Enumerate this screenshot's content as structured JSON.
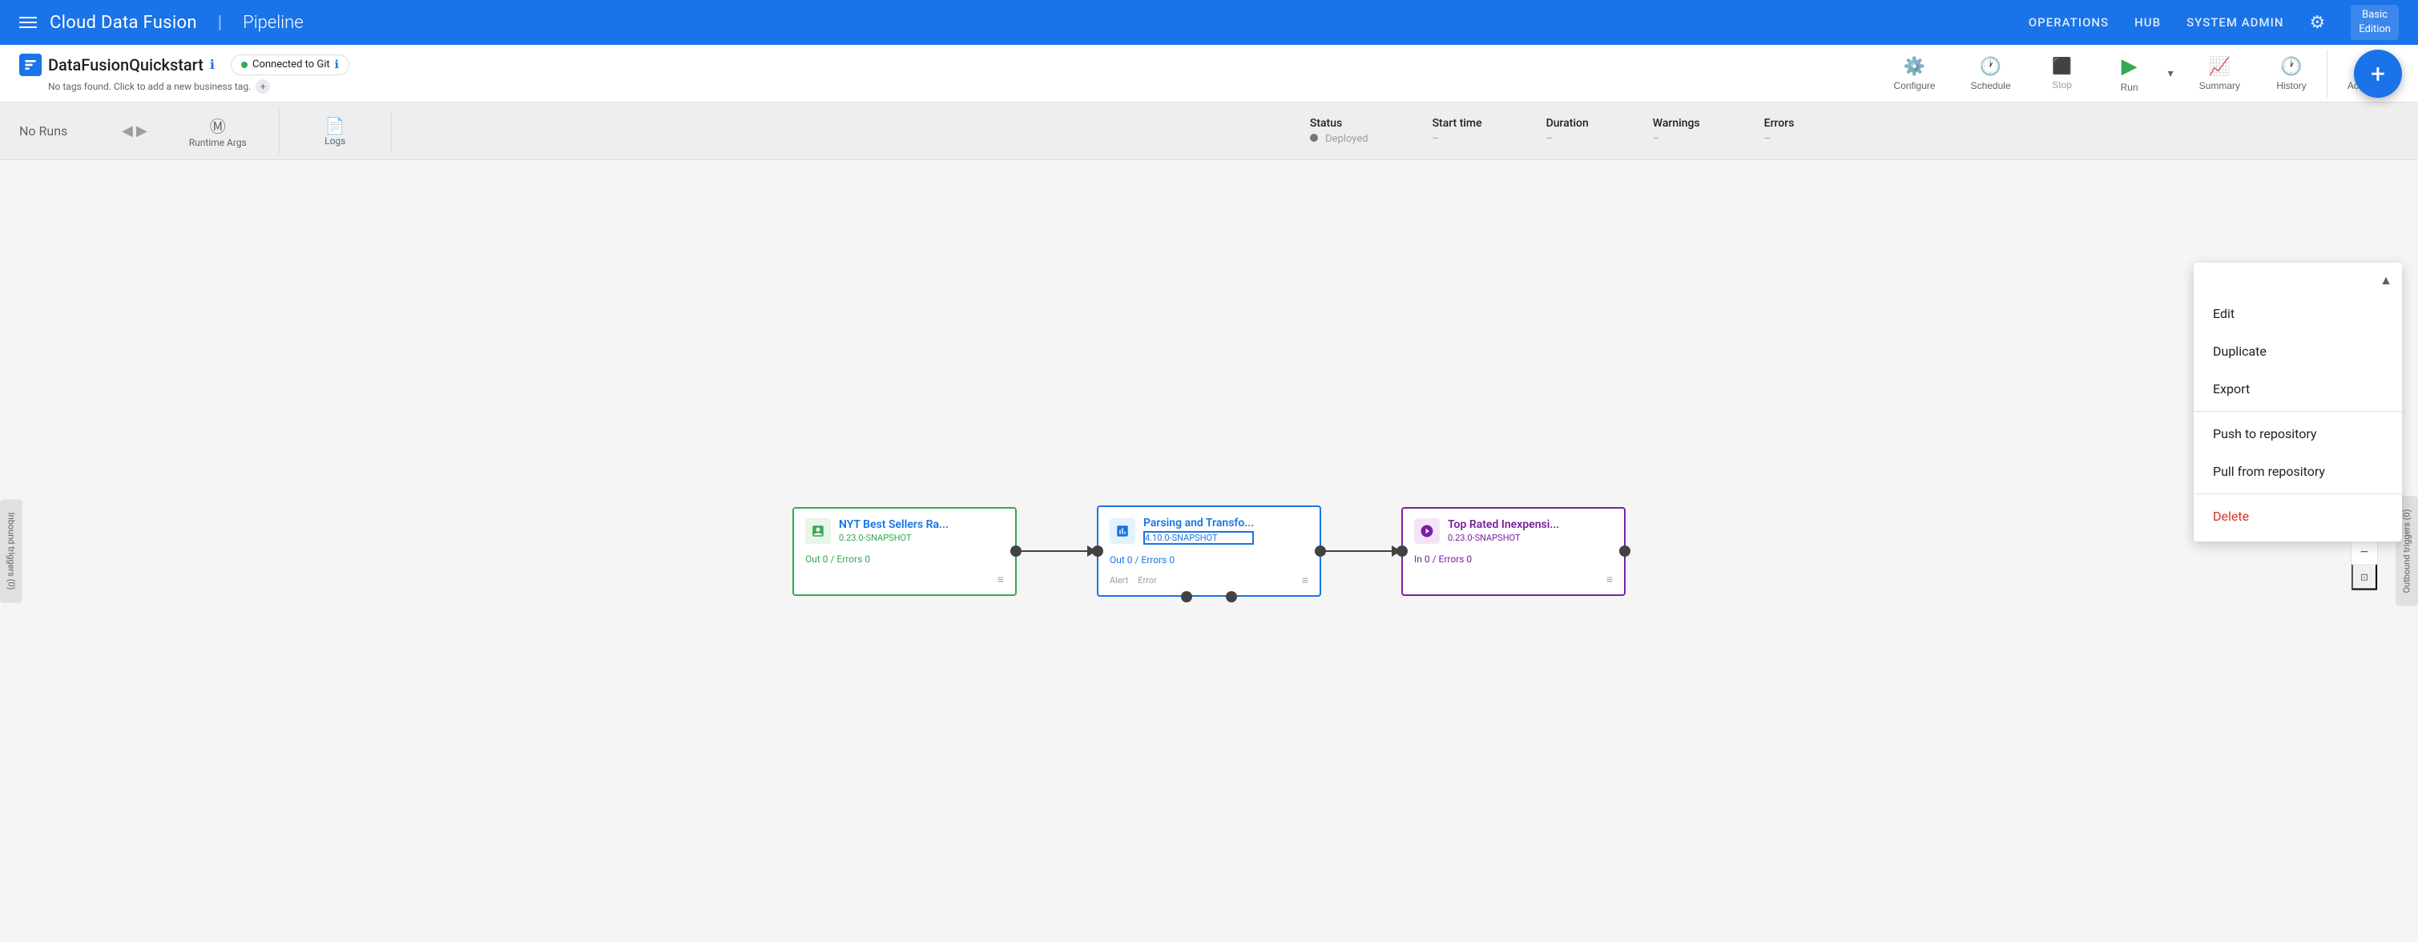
{
  "nav": {
    "hamburger_label": "menu",
    "app_title": "Cloud Data Fusion",
    "divider": "|",
    "section_title": "Pipeline",
    "links": [
      "OPERATIONS",
      "HUB",
      "SYSTEM ADMIN"
    ],
    "gear_label": "settings",
    "edition": "Basic\nEdition"
  },
  "toolbar": {
    "pipeline_name": "DataFusionQuickstart",
    "info_label": "ℹ",
    "git_badge": "Connected to Git",
    "git_info": "ℹ",
    "tags_text": "No tags found. Click to add a new business tag.",
    "add_tag": "+",
    "configure_label": "Configure",
    "schedule_label": "Schedule",
    "stop_label": "Stop",
    "run_label": "Run",
    "summary_label": "Summary",
    "history_label": "History",
    "actions_label": "Actions"
  },
  "run_bar": {
    "no_runs": "No Runs",
    "arrow_left": "◀",
    "arrow_right": "▶",
    "runtime_args_label": "Runtime Args",
    "logs_label": "Logs",
    "status_label": "Status",
    "status_value": "Deployed",
    "start_time_label": "Start time",
    "start_time_value": "–",
    "duration_label": "Duration",
    "duration_value": "–",
    "warnings_label": "Warnings",
    "warnings_value": "–",
    "errors_label": "Errors",
    "errors_value": "–"
  },
  "actions_menu": {
    "edit": "Edit",
    "duplicate": "Duplicate",
    "export": "Export",
    "push_to_repository": "Push to repository",
    "pull_from_repository": "Pull from repository",
    "delete": "Delete"
  },
  "nodes": [
    {
      "id": "source",
      "title": "NYT Best Sellers Ra...",
      "version": "0.23.0-SNAPSHOT",
      "stats": "Out 0 / Errors 0",
      "type": "source",
      "icon": "☁"
    },
    {
      "id": "transform",
      "title": "Parsing and Transfo...",
      "version": "4.10.0-SNAPSHOT",
      "stats": "Out 0 / Errors 0",
      "alert_label": "Alert",
      "error_label": "Error",
      "type": "transform",
      "icon": "⚡"
    },
    {
      "id": "sink",
      "title": "Top Rated Inexpensi...",
      "version": "0.23.0-SNAPSHOT",
      "stats": "In 0 / Errors 0",
      "type": "sink",
      "icon": "🔮"
    }
  ],
  "triggers": {
    "inbound": "Inbound triggers (0)",
    "outbound": "Outbound triggers (0)"
  },
  "colors": {
    "source_border": "#34a853",
    "transform_border": "#1a73e8",
    "sink_border": "#7b1fa2",
    "nav_bg": "#1a73e8",
    "delete_color": "#d93025"
  }
}
